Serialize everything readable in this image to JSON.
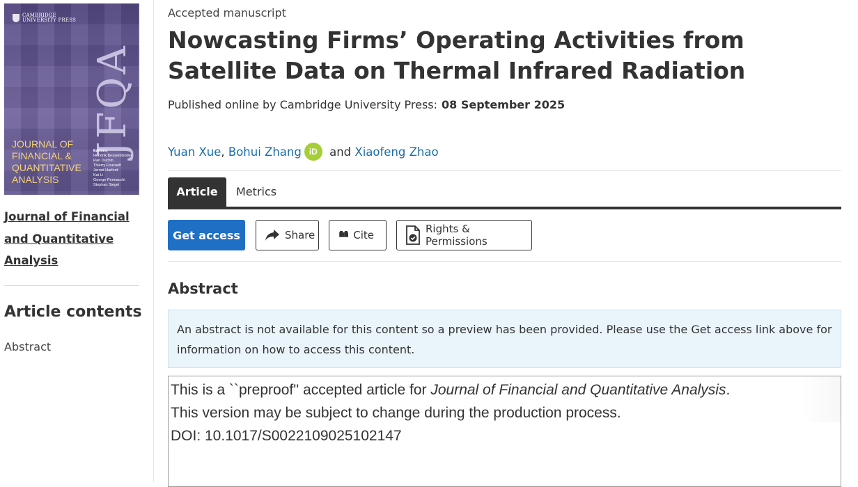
{
  "sidebar": {
    "cover": {
      "publisher": "CAMBRIDGE\nUNIVERSITY PRESS",
      "acronym": "JFQA",
      "title": "JOURNAL OF\nFINANCIAL &\nQUANTITATIVE\nANALYSIS",
      "editors_label": "Editors:",
      "editors": [
        "Hendrik Bessembinder",
        "Ran Duchin",
        "Thierry Foucault",
        "Jarrad Harford",
        "Kai Li",
        "George Pennacchi",
        "Stephan Siegel"
      ]
    },
    "journal_link": "Journal of Financial and Quantitative Analysis",
    "contents_heading": "Article contents",
    "contents_items": [
      "Abstract"
    ]
  },
  "article": {
    "status": "Accepted manuscript",
    "title": "Nowcasting Firms’ Operating Activities from Satellite Data on Thermal Infrared Radiation",
    "published_prefix": "Published online by Cambridge University Press:",
    "published_date": "08 September 2025",
    "authors": [
      "Yuan Xue",
      "Bohui Zhang",
      "Xiaofeng Zhao"
    ],
    "author_separator": ", ",
    "author_conjunction": " and ",
    "orcid_text": "iD"
  },
  "tabs": [
    "Article",
    "Metrics"
  ],
  "actions": {
    "get_access": "Get access",
    "share": "Share",
    "cite": "Cite",
    "rights": "Rights & Permissions"
  },
  "abstract": {
    "heading": "Abstract",
    "notice": "An abstract is not available for this content so a preview has been provided. Please use the Get access link above for information on how to access this content.",
    "preview_line1_prefix": "This is a ``preproof'' accepted article for ",
    "preview_line1_journal": "Journal of Financial and Quantitative Analysis",
    "preview_line1_suffix": ".",
    "preview_line2": "This version may be subject to change during the production process.",
    "preview_line3": "DOI: 10.1017/S0022109025102147"
  },
  "colors": {
    "link": "#1a6ea8",
    "primary_button": "#1f6fc5",
    "orcid": "#a6ce39",
    "notice_bg": "#eaf4fb",
    "cover": "#61558f",
    "cover_title": "#f3d27a"
  },
  "icons": [
    "share-icon",
    "quote-icon",
    "rights-document-icon",
    "orcid-icon"
  ]
}
